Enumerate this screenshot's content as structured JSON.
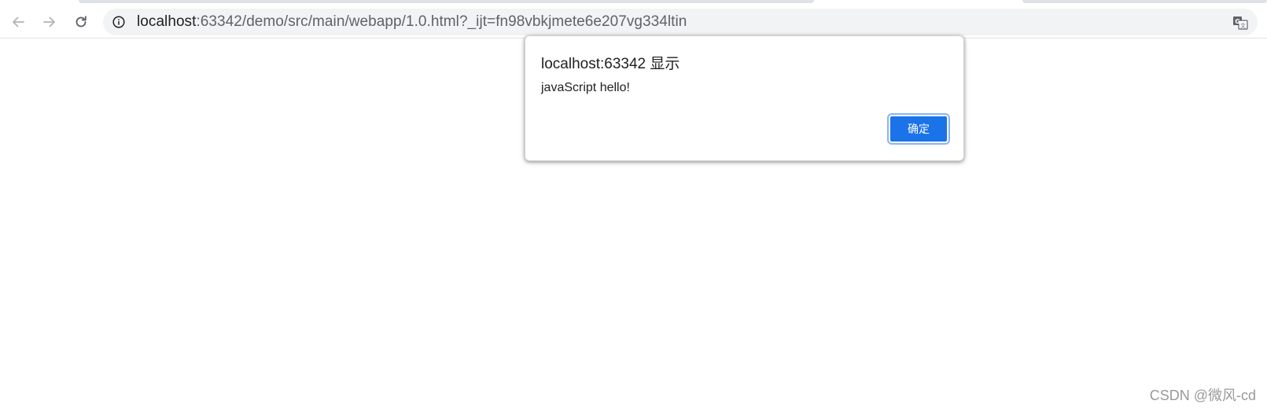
{
  "browser": {
    "url_host": "localhost",
    "url_rest": ":63342/demo/src/main/webapp/1.0.html?_ijt=fn98vbkjmete6e207vg334ltin",
    "icons": {
      "back": "arrow-left-icon",
      "forward": "arrow-right-icon",
      "reload": "reload-icon",
      "site_info": "info-icon",
      "translate": "translate-icon"
    }
  },
  "dialog": {
    "title": "localhost:63342 显示",
    "message": "javaScript hello!",
    "ok_label": "确定",
    "accent_color": "#1a73e8"
  },
  "watermark": {
    "text": "CSDN @微风-cd"
  }
}
